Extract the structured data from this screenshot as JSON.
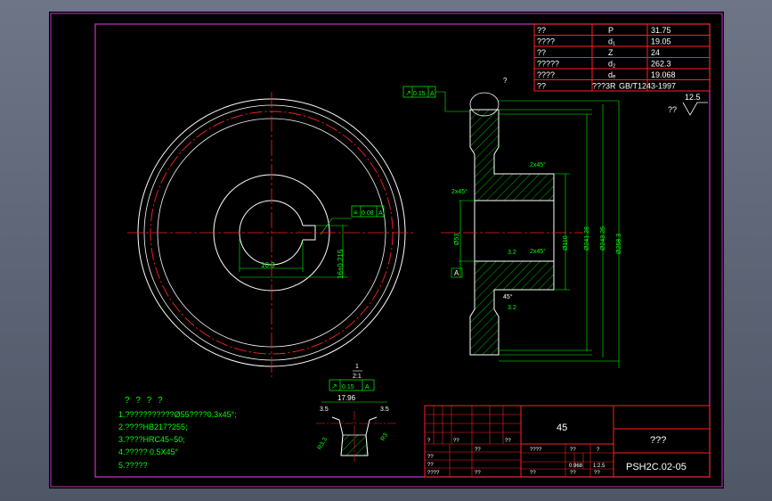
{
  "colors": {
    "viewport_bg": "#000000",
    "frame": "#c832c8",
    "geometry": "#ffffff",
    "centerline": "#ff2020",
    "dimension": "#00ff00",
    "table_line": "#ff2020",
    "table_text": "#ffffff"
  },
  "param_table": {
    "rows": [
      {
        "name": "??",
        "symbol": "P",
        "value": "31.75"
      },
      {
        "name": "????",
        "symbol": "d₁",
        "value": "19.05"
      },
      {
        "name": "??",
        "symbol": "Z",
        "value": "24"
      },
      {
        "name": "?????",
        "symbol": "d₂",
        "value": "262.3"
      },
      {
        "name": "????",
        "symbol": "dₑ",
        "value": "19.068"
      },
      {
        "name": "??",
        "symbol": "???3R",
        "value": "GB/T1243-1997"
      }
    ]
  },
  "tolerances": {
    "runout_top": {
      "symbol": "↗",
      "value": "0.15",
      "datum": "A"
    },
    "keyway_sym": {
      "symbol": "≡",
      "value": "0.08",
      "datum": "A"
    },
    "tooth_runout": {
      "symbol": "↗",
      "value": "0.15",
      "datum": "A"
    }
  },
  "front_view": {
    "keyway_width": "10.3",
    "keyway_depth": "16±0.215"
  },
  "section_view": {
    "bore_dia": "Ø53",
    "hub_dia": "Ø110",
    "dia_1": "Ø241.28",
    "dia_2": "Ø243.25",
    "dia_3": "Ø258.3",
    "chamfer_1": "2x45°",
    "chamfer_2": "2x45°",
    "chamfer_3": "2x45°",
    "roughness_1": "3.2",
    "roughness_2": "3.2",
    "angle": "45°",
    "label_a": "A",
    "callout": "?"
  },
  "tooth_detail": {
    "scale_num": "1",
    "scale_den": "2:1",
    "chord": "17.96",
    "dim_left": "3.5",
    "dim_right": "3.5",
    "r_left": "R3.3",
    "r_right": "R3"
  },
  "roughness_note": {
    "label": "??",
    "value": "12.5"
  },
  "notes": {
    "title": "? ? ? ?",
    "lines": [
      "1.???????????Ø55????0.3x45°;",
      "2.????HB217?255;",
      "3.????HRC45~50;",
      "4.?????  0.5X45°",
      "5.?????"
    ]
  },
  "title_block": {
    "material": "45",
    "part_name": "???",
    "drawing_no": "PSH2C.02-05",
    "row_labels": [
      "??",
      "??",
      "????",
      "??"
    ],
    "cells": [
      "?",
      "??",
      "??",
      "??",
      "????",
      "??",
      "?",
      "??",
      "??",
      "??",
      "0.968",
      "1:2.5"
    ]
  }
}
